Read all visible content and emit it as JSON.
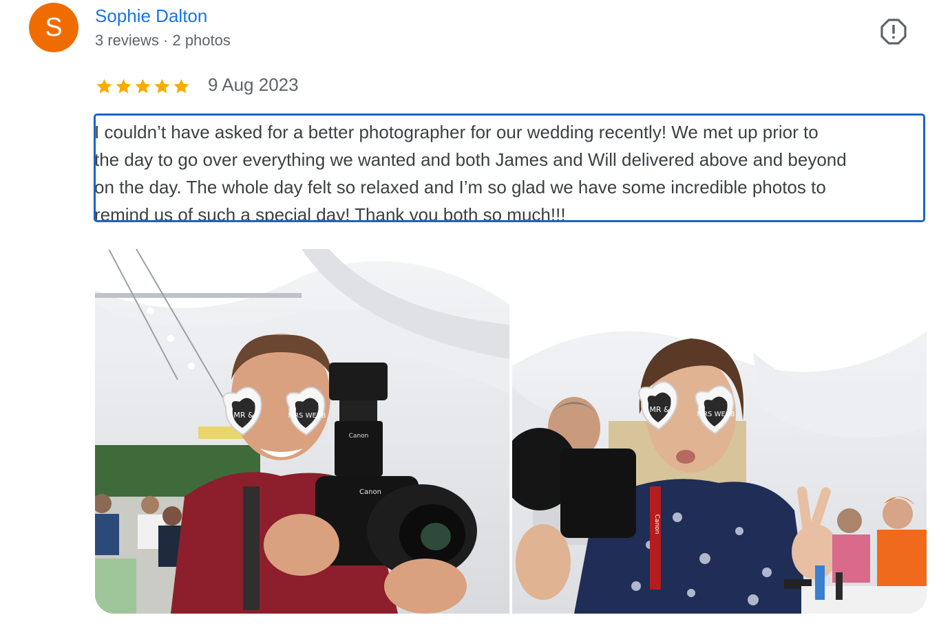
{
  "reviewer": {
    "initial": "S",
    "name": "Sophie Dalton",
    "meta": "3 reviews · 2 photos",
    "avatar_color": "#ef6c00"
  },
  "report_button": {
    "icon": "report-flag-icon"
  },
  "rating": {
    "stars": 5,
    "max": 5,
    "color": "#f9ab00"
  },
  "date": "9 Aug 2023",
  "review": {
    "lines": [
      "I couldn’t have asked for a better photographer for our wedding recently! We met up prior to",
      "the day to go over everything we wanted and both James and Will delivered above and beyond",
      "on the day. The whole day felt so relaxed and I’m so glad we have some incredible photos to",
      "remind us of such a special day! Thank you both so much!!!"
    ]
  },
  "photos": [
    {
      "glasses_left": "MR &",
      "glasses_right": "MRS WEBB",
      "camera_brand": "Canon",
      "flash_brand": "Canon"
    },
    {
      "glasses_left": "MR &",
      "glasses_right": "MRS WEBB",
      "camera_brand": "Canon"
    }
  ]
}
